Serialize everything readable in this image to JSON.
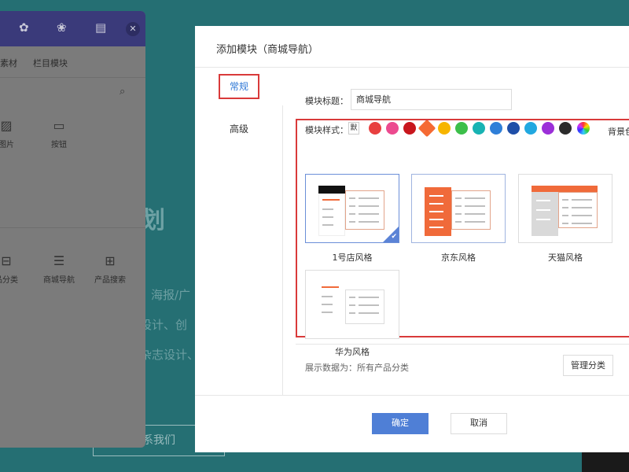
{
  "background": {
    "headline": "策划",
    "line1": "海报/广",
    "line2": "设计、创",
    "line3": "杂志设计、",
    "contact_button": "系我们"
  },
  "left_panel": {
    "header_icons": [
      "gear-icon",
      "paw-icon",
      "layout-icon"
    ],
    "close_icon": "close-icon",
    "tabs": [
      "素材",
      "栏目模块"
    ],
    "search_icon": "search-icon",
    "widgets_top": [
      {
        "label": "图片",
        "icon": "image-icon"
      },
      {
        "label": "按钮",
        "icon": "button-icon"
      }
    ],
    "widgets_bottom": [
      {
        "label": "品分类",
        "icon": "category-icon"
      },
      {
        "label": "商城导航",
        "icon": "mall-nav-icon"
      },
      {
        "label": "产品搜索",
        "icon": "product-search-icon"
      }
    ]
  },
  "modal": {
    "title": "添加模块（商城导航）",
    "nav": [
      "常规",
      "高级"
    ],
    "title_label": "模块标题：",
    "title_value": "商城导航",
    "style_label": "模块样式：",
    "default_chip": "默",
    "colors": [
      "#e84040",
      "#ec4a8f",
      "#c8161d",
      "#f56a33",
      "#f7b500",
      "#3cbf4a",
      "#18b3b3",
      "#2f7fd8",
      "#1f4fa8",
      "#21a8e0",
      "#9b2fd8",
      "#2b2b2b"
    ],
    "bg_color_label": "背景色",
    "styles": [
      {
        "caption": "1号店风格"
      },
      {
        "caption": "京东风格"
      },
      {
        "caption": "天猫风格"
      },
      {
        "caption": "华为风格"
      }
    ],
    "data_source": "展示数据为：所有产品分类",
    "manage_button": "管理分类",
    "ok_button": "确定",
    "cancel_button": "取消"
  }
}
